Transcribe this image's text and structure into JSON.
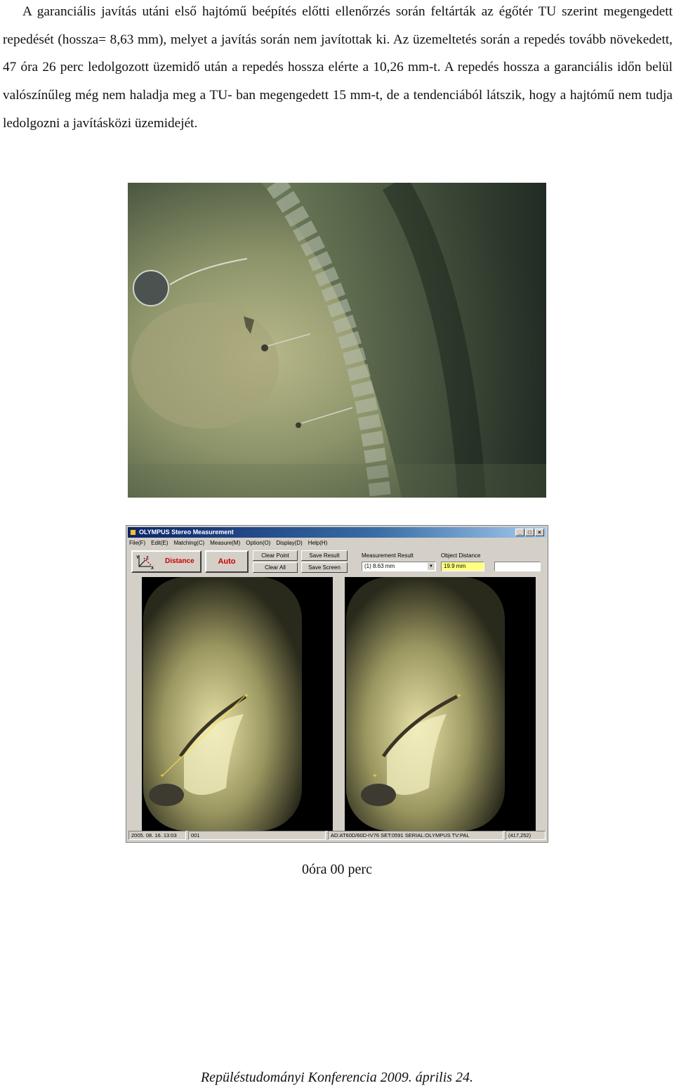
{
  "paragraph": {
    "line1": "A garanciális javítás utáni első hajtómű beépítés előtti ellenőrzés során feltárták az égőtér TU szerint",
    "rest": "megengedett repedését (hossza= 8,63 mm), melyet a javítás során nem javítottak ki. Az üzemeltetés során a repedés tovább növekedett, 47 óra 26 perc ledolgozott üzemidő után a repedés hossza elérte a 10,26 mm-t. A repedés hossza a garanciális időn belül valószínűleg még nem haladja meg a TU- ban megengedett 15 mm-t, de a tendenciából látszik, hogy a hajtómű nem tudja ledolgozni a javításközi üzemidejét."
  },
  "app": {
    "title": "OLYMPUS Stereo Measurement",
    "window_buttons": [
      "_",
      "□",
      "×"
    ],
    "menu": [
      "File(F)",
      "Edit(E)",
      "Matching(C)",
      "Measure(M)",
      "Option(O)",
      "Display(D)",
      "Help(H)"
    ],
    "toolbar": {
      "distance_label": "Distance",
      "auto_label": "Auto",
      "clear_point": "Clear Point",
      "clear_all": "Clear All",
      "save_result": "Save Result",
      "save_screen": "Save Screen",
      "measurement_result_label": "Measurement Result",
      "measurement_result_value": "(1)  8.63 mm",
      "object_distance_label": "Object Distance",
      "object_distance_value": "19.9 mm",
      "extra_field": ""
    },
    "statusbar": {
      "datetime": "2005. 08. 16. 13:03",
      "code": "001",
      "info": "AD:AT60D/60D-IV76   SET:0591   SERIAL:OLYMPUS   TV:PAL",
      "coords": "(417,252)"
    },
    "colors": {
      "titlebar": "#0a246a",
      "face": "#d4d0c8",
      "highlight_field": "#ffff80"
    }
  },
  "caption": "0óra 00 perc",
  "footer": "Repüléstudományi Konferencia 2009. április 24."
}
